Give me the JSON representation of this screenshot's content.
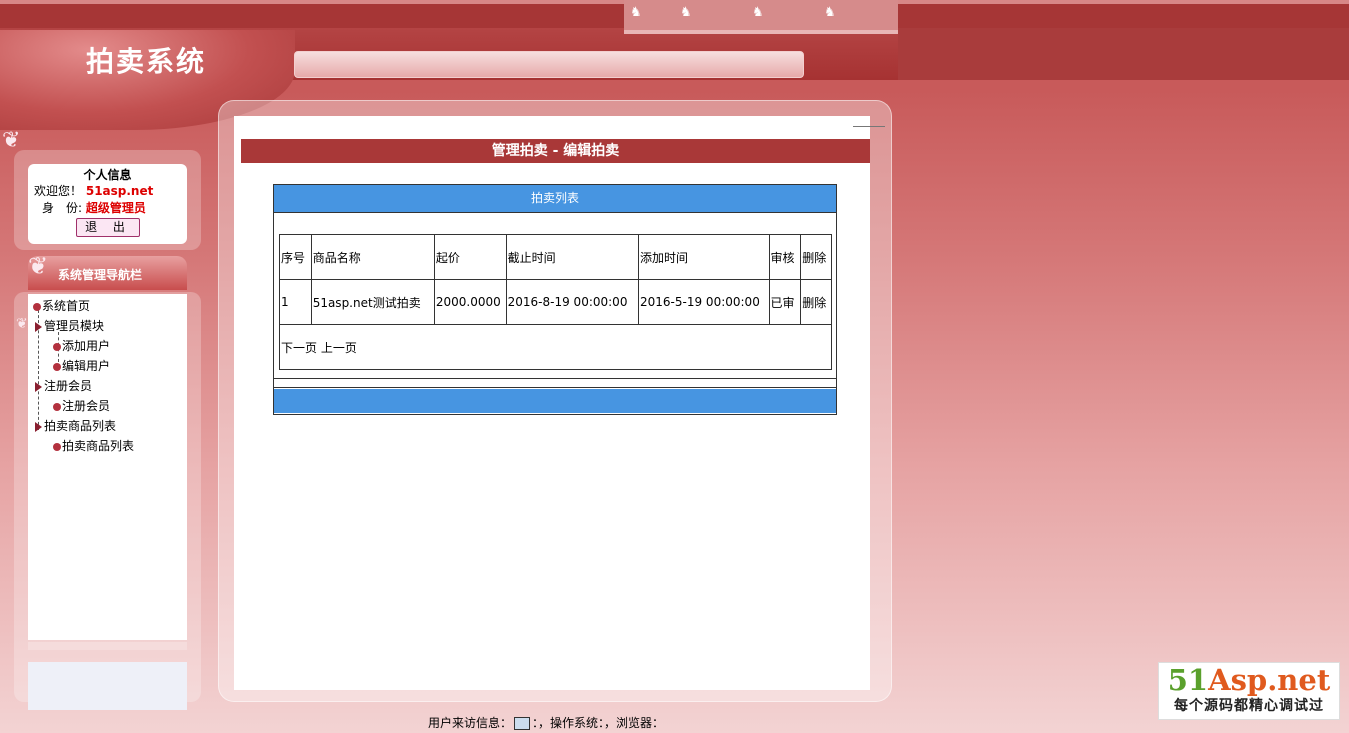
{
  "header": {
    "site_title": "拍卖系统"
  },
  "sidebar": {
    "info_title": "个人信息",
    "welcome_label": "欢迎您！",
    "username": "51asp.net",
    "role_label": "身　份:",
    "role_value": "超级管理员",
    "logout_label": "退 出",
    "nav_title": "系统管理导航栏",
    "nav_items": [
      {
        "label": "系统首页"
      },
      {
        "label": "管理员模块"
      },
      {
        "label": "添加用户"
      },
      {
        "label": "编辑用户"
      },
      {
        "label": "注册会员"
      },
      {
        "label": "注册会员"
      },
      {
        "label": "拍卖商品列表"
      },
      {
        "label": "拍卖商品列表"
      }
    ]
  },
  "main": {
    "page_title": "管理拍卖 - 编辑拍卖",
    "grid_title": "拍卖列表",
    "columns": [
      "序号",
      "商品名称",
      "起价",
      "截止时间",
      "添加时间",
      "审核",
      "删除"
    ],
    "rows": [
      [
        "1",
        "51asp.net测试拍卖",
        "2000.0000",
        "2016-8-19 00:00:00",
        "2016-5-19 00:00:00",
        "已审",
        "删除"
      ]
    ],
    "pager": "下一页 上一页"
  },
  "footer": {
    "visitor_info_label": "用户来访信息：",
    "os_label": "：，操作系统：，浏览器："
  },
  "watermark": {
    "brand_prefix": "51",
    "brand_suffix": "Asp.net",
    "tagline": "每个源码都精心调试过"
  },
  "colors": {
    "header_red": "#a93838",
    "grid_blue": "#4795e1",
    "accent_red": "#d00000"
  }
}
